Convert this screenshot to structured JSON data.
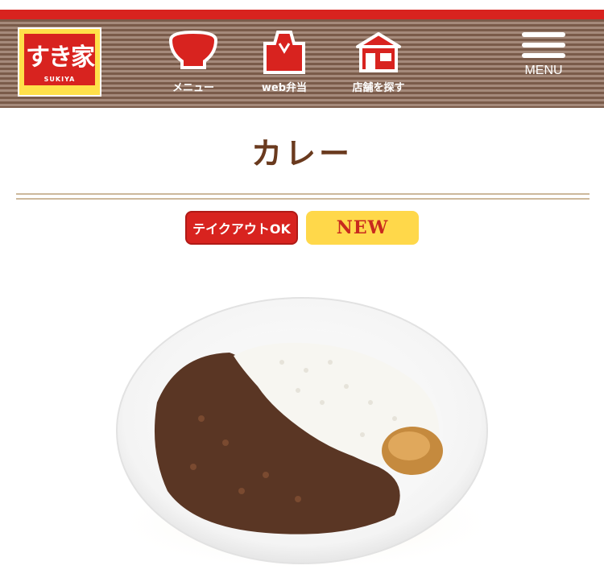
{
  "header": {
    "logo": {
      "text": "すき家",
      "sub": "SUKIYA",
      "icon": "sukiya-logo"
    },
    "nav": [
      {
        "label": "メニュー",
        "icon": "bowl-icon"
      },
      {
        "label": "web弁当",
        "icon": "takeout-bag-icon"
      },
      {
        "label": "店舗を探す",
        "icon": "store-icon"
      }
    ],
    "menu_label": "MENU",
    "menu_icon": "hamburger-icon"
  },
  "page": {
    "title": "カレー",
    "badges": {
      "takeout": "テイクアウトOK",
      "new": "NEW"
    },
    "image": "curry-rice-plate"
  },
  "colors": {
    "brand_red": "#d8231f",
    "header_brown": "#7a5b4a",
    "title_brown": "#6a3a1e",
    "badge_yellow": "#ffd84a"
  }
}
